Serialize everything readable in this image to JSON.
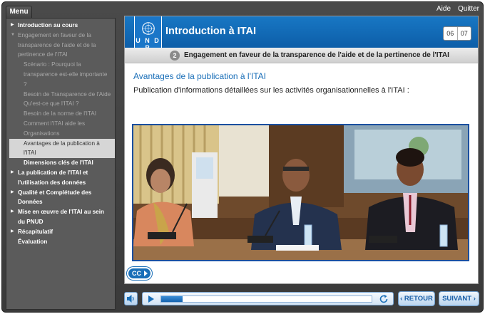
{
  "topbar": {
    "menu_label": "Menu",
    "help_label": "Aide",
    "quit_label": "Quitter"
  },
  "sidebar": {
    "items": [
      {
        "label": "Introduction au cours",
        "level": 1,
        "style": "bold",
        "marker": "collapsed"
      },
      {
        "label": "Engagement en faveur de la transparence de l'aide et de la pertinence de l'ITAI",
        "level": 1,
        "style": "dim",
        "marker": "expanded"
      },
      {
        "label": "Scénario : Pourquoi la transparence est-elle importante ?",
        "level": 2,
        "style": "dim"
      },
      {
        "label": "Besoin de Transparence de l'Aide",
        "level": 2,
        "style": "dim"
      },
      {
        "label": "Qu'est-ce que l'ITAI ?",
        "level": 2,
        "style": "dim"
      },
      {
        "label": "Besoin de la norme de l'ITAI",
        "level": 2,
        "style": "dim"
      },
      {
        "label": "Comment l'ITAI aide les Organisations",
        "level": 2,
        "style": "dim"
      },
      {
        "label": "Avantages de la publication à l'ITAI",
        "level": 2,
        "style": "active"
      },
      {
        "label": "Dimensions clés de l'ITAI",
        "level": 2,
        "style": "bold"
      },
      {
        "label": "La publication de l'ITAI et l'utilisation des données",
        "level": 1,
        "style": "bold",
        "marker": "collapsed"
      },
      {
        "label": "Qualité et Complétude des Données",
        "level": 1,
        "style": "bold",
        "marker": "collapsed"
      },
      {
        "label": "Mise en œuvre de l'ITAI au sein du PNUD",
        "level": 1,
        "style": "bold",
        "marker": "collapsed"
      },
      {
        "label": "Récapitulatif",
        "level": 1,
        "style": "bold",
        "marker": "collapsed"
      },
      {
        "label": "Évaluation",
        "level": 1,
        "style": "bold",
        "marker": "none"
      }
    ]
  },
  "header": {
    "logo_text": "U N D P",
    "logo_tagline": "Empowered lives. Resilient nations.",
    "course_title": "Introduction à ITAI",
    "page_current": "06",
    "page_total": "07"
  },
  "section": {
    "number": "2",
    "title": "Engagement en faveur de la transparence de l'aide et de la pertinence de l'ITAI"
  },
  "page": {
    "heading": "Avantages de la publication à l'ITAI",
    "intro": "Publication d'informations détaillées sur les activités organisationnelles à l'ITAI :"
  },
  "controls": {
    "cc_label": "CC",
    "progress_fraction": 0.1,
    "back_label": "RETOUR",
    "next_label": "SUIVANT"
  },
  "icons": {
    "toc_collapsed": "triangle-right",
    "toc_expanded": "triangle-down",
    "volume": "speaker-icon",
    "play": "play-icon",
    "replay": "replay-icon",
    "back": "chevron-left-icon",
    "next": "chevron-right-icon"
  },
  "colors": {
    "accent_blue": "#1a6fb8",
    "header_blue": "#1877c4",
    "sidebar_bg": "#5b5b5b",
    "active_item_bg": "#d6d6d6"
  }
}
